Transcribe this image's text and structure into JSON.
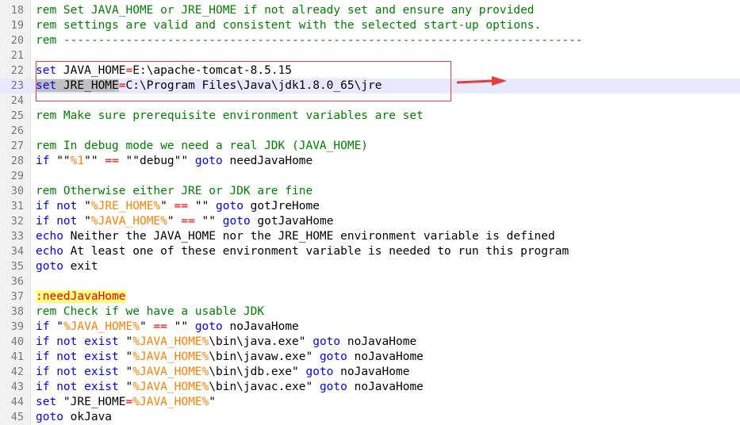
{
  "colors": {
    "comment": "#008000",
    "keyword": "#0000ff",
    "variable": "#ff8000",
    "operator": "#ff0000",
    "text": "#000000",
    "line_number": "#787878",
    "label": "#ff0000",
    "label_highlight": "#ffff80",
    "current_line": "#e8e8ff",
    "selection": "#c0c0c0",
    "annotation_red": "#e83c3c"
  },
  "editor": {
    "lines": [
      {
        "num": "18",
        "tokens": [
          {
            "t": "rem Set JAVA_HOME or JRE_HOME if not already set and ensure any provided",
            "c": "comment"
          }
        ]
      },
      {
        "num": "19",
        "tokens": [
          {
            "t": "rem settings are valid and consistent with the selected start-up options.",
            "c": "comment"
          }
        ]
      },
      {
        "num": "20",
        "tokens": [
          {
            "t": "rem ---------------------------------------------------------------------------",
            "c": "comment"
          }
        ]
      },
      {
        "num": "21",
        "tokens": []
      },
      {
        "num": "22",
        "tokens": [
          {
            "t": "set",
            "c": "keyword"
          },
          {
            "t": " JAVA_HOME",
            "c": "text"
          },
          {
            "t": "=",
            "c": "operator"
          },
          {
            "t": "E:\\apache-tomcat-8.5.15",
            "c": "text"
          }
        ]
      },
      {
        "num": "23",
        "current": true,
        "tokens": [
          {
            "t": "set",
            "c": "keyword",
            "sel": true
          },
          {
            "t": " JRE_HOME",
            "c": "text",
            "sel": true
          },
          {
            "t": "=",
            "c": "operator"
          },
          {
            "t": "C:\\Program Files\\Java\\jdk1.8.0_65\\jre",
            "c": "text"
          }
        ]
      },
      {
        "num": "24",
        "tokens": []
      },
      {
        "num": "25",
        "tokens": [
          {
            "t": "rem Make sure prerequisite environment variables are set",
            "c": "comment"
          }
        ]
      },
      {
        "num": "26",
        "tokens": []
      },
      {
        "num": "27",
        "tokens": [
          {
            "t": "rem In debug mode we need a real JDK (JAVA_HOME)",
            "c": "comment"
          }
        ]
      },
      {
        "num": "28",
        "tokens": [
          {
            "t": "if",
            "c": "keyword"
          },
          {
            "t": " \"\"",
            "c": "text"
          },
          {
            "t": "%1",
            "c": "variable"
          },
          {
            "t": "\"\" ",
            "c": "text"
          },
          {
            "t": "==",
            "c": "operator"
          },
          {
            "t": " \"\"debug\"\" ",
            "c": "text"
          },
          {
            "t": "goto",
            "c": "keyword"
          },
          {
            "t": " needJavaHome",
            "c": "text"
          }
        ]
      },
      {
        "num": "29",
        "tokens": []
      },
      {
        "num": "30",
        "tokens": [
          {
            "t": "rem Otherwise either JRE or JDK are fine",
            "c": "comment"
          }
        ]
      },
      {
        "num": "31",
        "tokens": [
          {
            "t": "if not",
            "c": "keyword"
          },
          {
            "t": " \"",
            "c": "text"
          },
          {
            "t": "%JRE_HOME%",
            "c": "variable"
          },
          {
            "t": "\" ",
            "c": "text"
          },
          {
            "t": "==",
            "c": "operator"
          },
          {
            "t": " \"\" ",
            "c": "text"
          },
          {
            "t": "goto",
            "c": "keyword"
          },
          {
            "t": " gotJreHome",
            "c": "text"
          }
        ]
      },
      {
        "num": "32",
        "tokens": [
          {
            "t": "if not",
            "c": "keyword"
          },
          {
            "t": " \"",
            "c": "text"
          },
          {
            "t": "%JAVA_HOME%",
            "c": "variable"
          },
          {
            "t": "\" ",
            "c": "text"
          },
          {
            "t": "==",
            "c": "operator"
          },
          {
            "t": " \"\" ",
            "c": "text"
          },
          {
            "t": "goto",
            "c": "keyword"
          },
          {
            "t": " gotJavaHome",
            "c": "text"
          }
        ]
      },
      {
        "num": "33",
        "tokens": [
          {
            "t": "echo",
            "c": "keyword"
          },
          {
            "t": " Neither the JAVA_HOME nor the JRE_HOME environment variable is defined",
            "c": "text"
          }
        ]
      },
      {
        "num": "34",
        "tokens": [
          {
            "t": "echo",
            "c": "keyword"
          },
          {
            "t": " At least one of these environment variable is needed to run this program",
            "c": "text"
          }
        ]
      },
      {
        "num": "35",
        "tokens": [
          {
            "t": "goto",
            "c": "keyword"
          },
          {
            "t": " exit",
            "c": "text"
          }
        ]
      },
      {
        "num": "36",
        "tokens": []
      },
      {
        "num": "37",
        "tokens": [
          {
            "t": ":needJavaHome",
            "c": "label",
            "hl": true
          }
        ]
      },
      {
        "num": "38",
        "tokens": [
          {
            "t": "rem Check if we have a usable JDK",
            "c": "comment"
          }
        ]
      },
      {
        "num": "39",
        "tokens": [
          {
            "t": "if",
            "c": "keyword"
          },
          {
            "t": " \"",
            "c": "text"
          },
          {
            "t": "%JAVA_HOME%",
            "c": "variable"
          },
          {
            "t": "\" ",
            "c": "text"
          },
          {
            "t": "==",
            "c": "operator"
          },
          {
            "t": " \"\" ",
            "c": "text"
          },
          {
            "t": "goto",
            "c": "keyword"
          },
          {
            "t": " noJavaHome",
            "c": "text"
          }
        ]
      },
      {
        "num": "40",
        "tokens": [
          {
            "t": "if not exist",
            "c": "keyword"
          },
          {
            "t": " \"",
            "c": "text"
          },
          {
            "t": "%JAVA_HOME%",
            "c": "variable"
          },
          {
            "t": "\\bin\\java.exe\" ",
            "c": "text"
          },
          {
            "t": "goto",
            "c": "keyword"
          },
          {
            "t": " noJavaHome",
            "c": "text"
          }
        ]
      },
      {
        "num": "41",
        "tokens": [
          {
            "t": "if not exist",
            "c": "keyword"
          },
          {
            "t": " \"",
            "c": "text"
          },
          {
            "t": "%JAVA_HOME%",
            "c": "variable"
          },
          {
            "t": "\\bin\\javaw.exe\" ",
            "c": "text"
          },
          {
            "t": "goto",
            "c": "keyword"
          },
          {
            "t": " noJavaHome",
            "c": "text"
          }
        ]
      },
      {
        "num": "42",
        "tokens": [
          {
            "t": "if not exist",
            "c": "keyword"
          },
          {
            "t": " \"",
            "c": "text"
          },
          {
            "t": "%JAVA_HOME%",
            "c": "variable"
          },
          {
            "t": "\\bin\\jdb.exe\" ",
            "c": "text"
          },
          {
            "t": "goto",
            "c": "keyword"
          },
          {
            "t": " noJavaHome",
            "c": "text"
          }
        ]
      },
      {
        "num": "43",
        "tokens": [
          {
            "t": "if not exist",
            "c": "keyword"
          },
          {
            "t": " \"",
            "c": "text"
          },
          {
            "t": "%JAVA_HOME%",
            "c": "variable"
          },
          {
            "t": "\\bin\\javac.exe\" ",
            "c": "text"
          },
          {
            "t": "goto",
            "c": "keyword"
          },
          {
            "t": " noJavaHome",
            "c": "text"
          }
        ]
      },
      {
        "num": "44",
        "tokens": [
          {
            "t": "set",
            "c": "keyword"
          },
          {
            "t": " \"JRE_HOME",
            "c": "text"
          },
          {
            "t": "=",
            "c": "operator"
          },
          {
            "t": "%JAVA_HOME%",
            "c": "variable"
          },
          {
            "t": "\"",
            "c": "text"
          }
        ]
      },
      {
        "num": "45",
        "tokens": [
          {
            "t": "goto",
            "c": "keyword"
          },
          {
            "t": " okJava",
            "c": "text"
          }
        ]
      }
    ]
  }
}
